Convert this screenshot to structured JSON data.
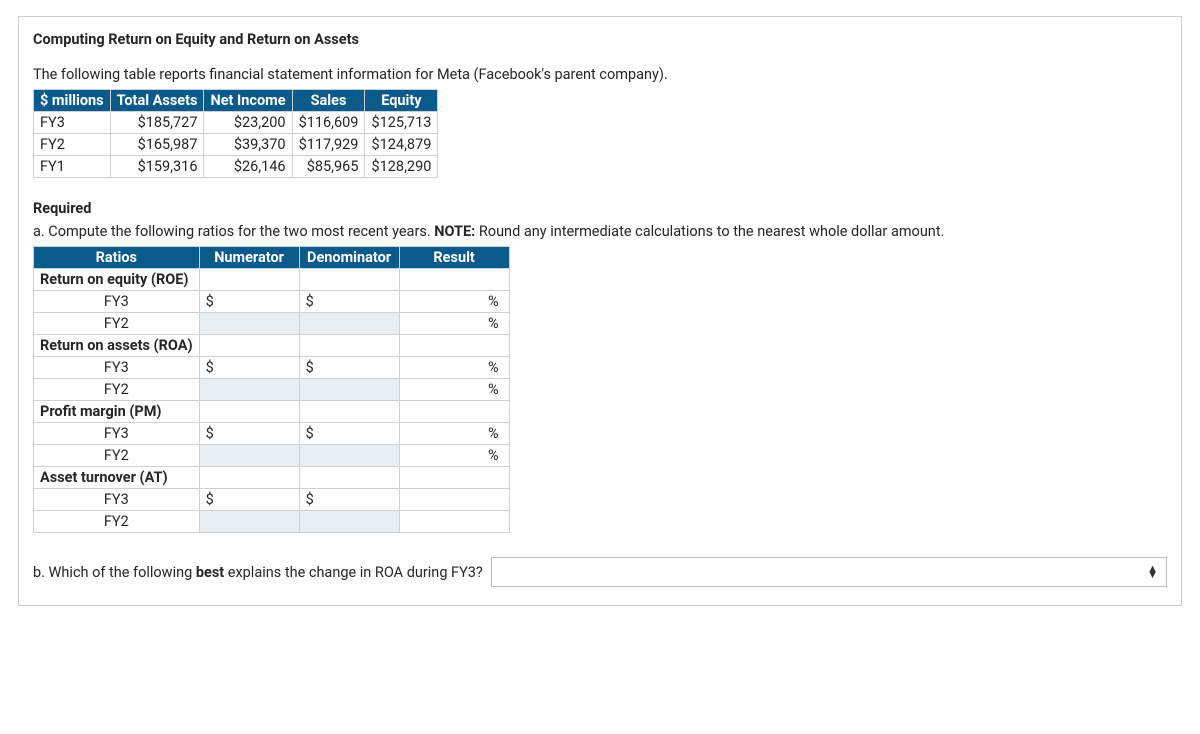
{
  "title": "Computing Return on Equity and Return on Assets",
  "intro": "The following table reports financial statement information for Meta (Facebook's parent company).",
  "data_table": {
    "headers": [
      "$ millions",
      "Total Assets",
      "Net Income",
      "Sales",
      "Equity"
    ],
    "rows": [
      {
        "fy": "FY3",
        "total_assets": "$185,727",
        "net_income": "$23,200",
        "sales": "$116,609",
        "equity": "$125,713"
      },
      {
        "fy": "FY2",
        "total_assets": "$165,987",
        "net_income": "$39,370",
        "sales": "$117,929",
        "equity": "$124,879"
      },
      {
        "fy": "FY1",
        "total_assets": "$159,316",
        "net_income": "$26,146",
        "sales": "$85,965",
        "equity": "$128,290"
      }
    ]
  },
  "required_label": "Required",
  "part_a": {
    "prefix": "a. Compute the following ratios for the two most recent years. ",
    "note_label": "NOTE:",
    "note_text": " Round any intermediate calculations to the nearest whole dollar amount."
  },
  "ratios_table": {
    "headers": [
      "Ratios",
      "Numerator",
      "Denominator",
      "Result"
    ],
    "sections": [
      {
        "label": "Return on equity (ROE)",
        "rows": [
          "FY3",
          "FY2"
        ],
        "prefix": "$",
        "suffix": "%"
      },
      {
        "label": "Return on assets (ROA)",
        "rows": [
          "FY3",
          "FY2"
        ],
        "prefix": "$",
        "suffix": "%"
      },
      {
        "label": "Profit margin (PM)",
        "rows": [
          "FY3",
          "FY2"
        ],
        "prefix": "$",
        "suffix": "%"
      },
      {
        "label": "Asset turnover (AT)",
        "rows": [
          "FY3",
          "FY2"
        ],
        "prefix": "$",
        "suffix": ""
      }
    ]
  },
  "part_b": {
    "prefix": "b. Which of the following ",
    "bold": "best",
    "suffix": " explains the change in ROA during FY3?"
  }
}
